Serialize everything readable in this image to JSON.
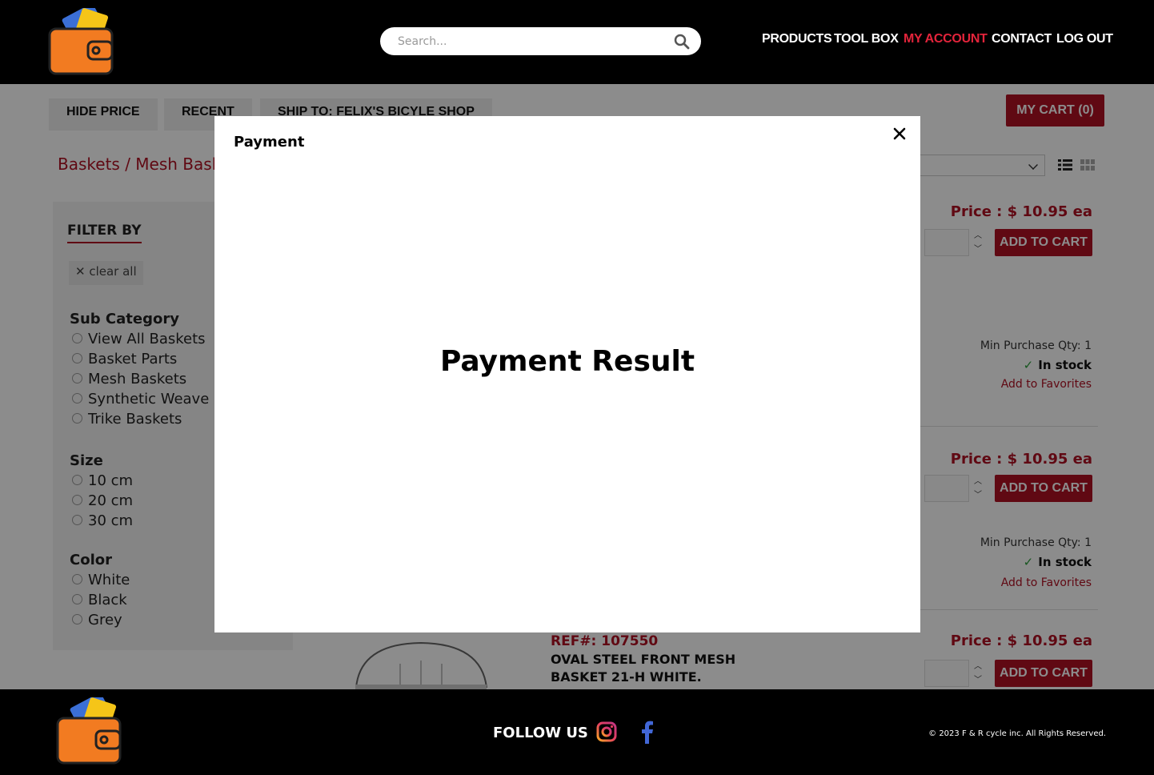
{
  "header": {
    "search_placeholder": "Search...",
    "nav": [
      {
        "label": "PRODUCTS",
        "active": false
      },
      {
        "label": "TOOL BOX",
        "active": false
      },
      {
        "label": "MY ACCOUNT",
        "active": true
      },
      {
        "label": "CONTACT",
        "active": false
      },
      {
        "label": "LOG OUT",
        "active": false
      }
    ],
    "accent_color": "#e3243b"
  },
  "toolbar": {
    "hide_price": "HIDE PRICE",
    "recent": "RECENT",
    "ship_to": "SHIP TO: FELIX'S BICYLE SHOP",
    "cart": "MY CART (0)"
  },
  "breadcrumb": "Baskets / Mesh Baske",
  "filters": {
    "title": "FILTER BY",
    "clear_all": "clear all",
    "groups": [
      {
        "name": "Sub Category",
        "options": [
          "View All Baskets",
          "Basket Parts",
          "Mesh Baskets",
          "Synthetic Weave Ba",
          "Trike Baskets"
        ]
      },
      {
        "name": "Size",
        "options": [
          "10 cm",
          "20 cm",
          "30 cm"
        ]
      },
      {
        "name": "Color",
        "options": [
          "White",
          "Black",
          "Grey"
        ]
      }
    ]
  },
  "products": [
    {
      "price": "Price : $ 10.95 ea",
      "add_to_cart": "ADD TO CART",
      "min_qty": "Min Purchase Qty: 1",
      "stock": "In stock",
      "favorites": "Add to Favorites"
    },
    {
      "price": "Price : $ 10.95 ea",
      "add_to_cart": "ADD TO CART",
      "min_qty": "Min Purchase Qty: 1",
      "stock": "In stock",
      "favorites": "Add to Favorites"
    },
    {
      "price": "Price : $ 10.95 ea",
      "add_to_cart": "ADD TO CART",
      "ref": "REF#: 107550",
      "name": "OVAL STEEL FRONT MESH BASKET 21-H WHITE."
    }
  ],
  "modal": {
    "title": "Payment",
    "heading": "Payment Result",
    "close_symbol": "✕"
  },
  "footer": {
    "follow_us": "FOLLOW US",
    "copyright": "© 2023 F & R cycle inc. All Rights Reserved."
  },
  "colors": {
    "brand_red": "#b01124",
    "header_bg": "#000000"
  }
}
